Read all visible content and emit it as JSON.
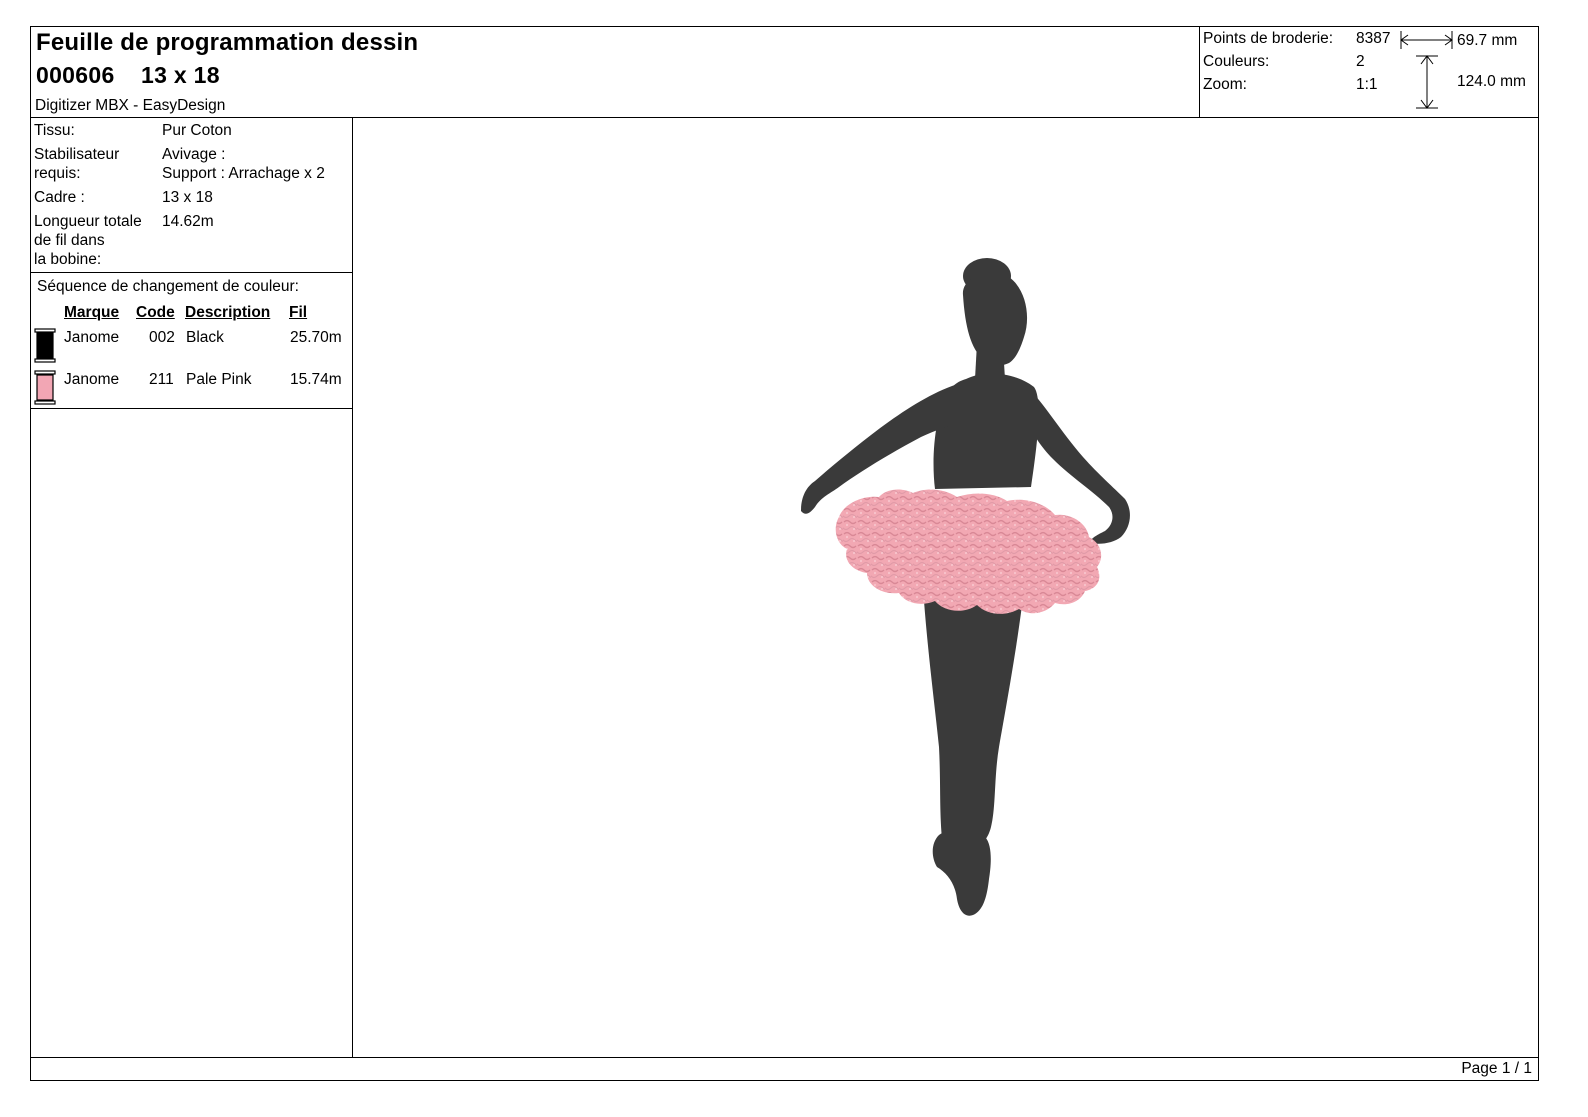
{
  "header": {
    "title": "Feuille de programmation dessin",
    "design_code": "000606",
    "frame_size": "13 x 18",
    "software": "Digitizer MBX - EasyDesign"
  },
  "stats": {
    "stitches_label": "Points de broderie:",
    "stitches_value": "8387",
    "colors_label": "Couleurs:",
    "colors_value": "2",
    "zoom_label": "Zoom:",
    "zoom_value": "1:1",
    "width": "69.7 mm",
    "height": "124.0 mm"
  },
  "info": {
    "fabric_label": "Tissu:",
    "fabric_value": "Pur Coton",
    "stabilizer_label_1": "Stabilisateur",
    "stabilizer_label_2": "requis:",
    "stabilizer_value_1": "Avivage :",
    "stabilizer_value_2": "Support : Arrachage x 2",
    "frame_label": "Cadre :",
    "frame_value": "13 x 18",
    "thread_label_1": "Longueur totale",
    "thread_label_2": "de fil dans",
    "thread_label_3": "la bobine:",
    "thread_value": "14.62m"
  },
  "sequence": {
    "title": "Séquence de changement de couleur:",
    "headers": {
      "brand": "Marque",
      "code": "Code",
      "description": "Description",
      "thread": "Fil"
    },
    "rows": [
      {
        "brand": "Janome",
        "code": "002",
        "description": "Black",
        "thread": "25.70m",
        "color": "#000000"
      },
      {
        "brand": "Janome",
        "code": "211",
        "description": "Pale Pink",
        "thread": "15.74m",
        "color": "#f2a6b4"
      }
    ]
  },
  "design": {
    "body_color": "#3a3a3a",
    "tutu_color": "#f2a8b3"
  },
  "footer": {
    "page": "Page 1 / 1"
  }
}
